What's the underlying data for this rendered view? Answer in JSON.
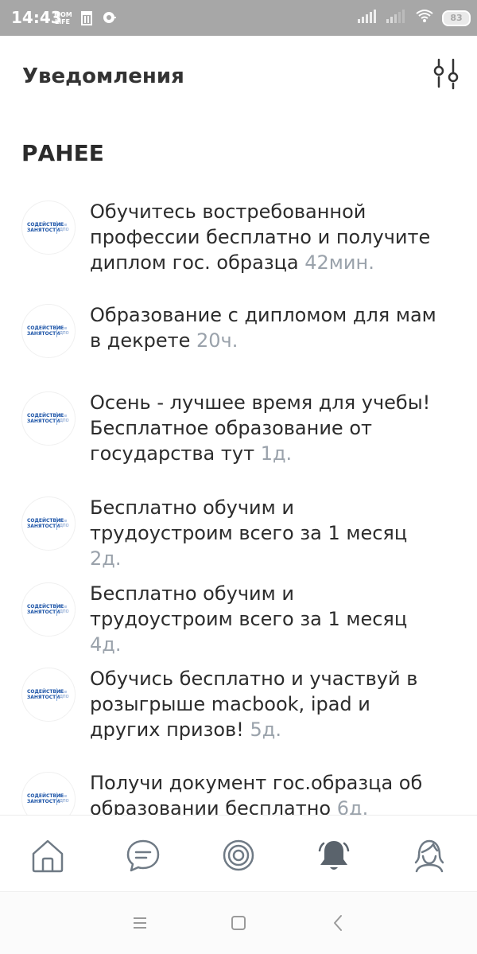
{
  "status_bar": {
    "time": "14:43",
    "battery": "83",
    "icons": [
      "mom-life-icon",
      "trash-icon",
      "chat-bubble-icon",
      "signal-icon",
      "signal-icon-2",
      "wifi-icon",
      "battery-icon"
    ]
  },
  "header": {
    "title": "Уведомления",
    "filter_icon": "sliders-icon"
  },
  "section": {
    "title": "РАНЕЕ"
  },
  "logo": {
    "line1": "СОДЕЙСТВИЕ",
    "line2": "ЗАНЯТОСТИ",
    "right1": "Все",
    "right2": "ДПО"
  },
  "notifications": [
    {
      "text": "Обучитесь востребованной профессии бесплатно и получите диплом гос. образца",
      "time": "42мин."
    },
    {
      "text": "Образование с дипломом для мам в декрете",
      "time": "20ч."
    },
    {
      "text": "Осень - лучшее время для учебы! Бесплатное образование от государства тут",
      "time": "1д."
    },
    {
      "text": "Бесплатно обучим и трудоустроим всего за 1 месяц",
      "time": "2д."
    },
    {
      "text": "Бесплатно обучим и трудоустроим всего за 1 месяц",
      "time": "4д."
    },
    {
      "text": "Обучись бесплатно и участвуй в розыгрыше macbook, ipad и других призов!",
      "time": "5д."
    },
    {
      "text": "Получи документ гос.образца об образовании бесплатно",
      "time": "6д."
    }
  ],
  "bottom_nav": [
    {
      "icon": "home-icon",
      "active": false
    },
    {
      "icon": "chat-icon",
      "active": false
    },
    {
      "icon": "target-icon",
      "active": false
    },
    {
      "icon": "bell-icon",
      "active": true
    },
    {
      "icon": "profile-icon",
      "active": false
    }
  ],
  "colors": {
    "accent_nav_active": "#4a4a4a",
    "nav_inactive": "#6f7a85",
    "time_gray": "#9aa2ab",
    "logo_blue": "#1f56a8"
  }
}
